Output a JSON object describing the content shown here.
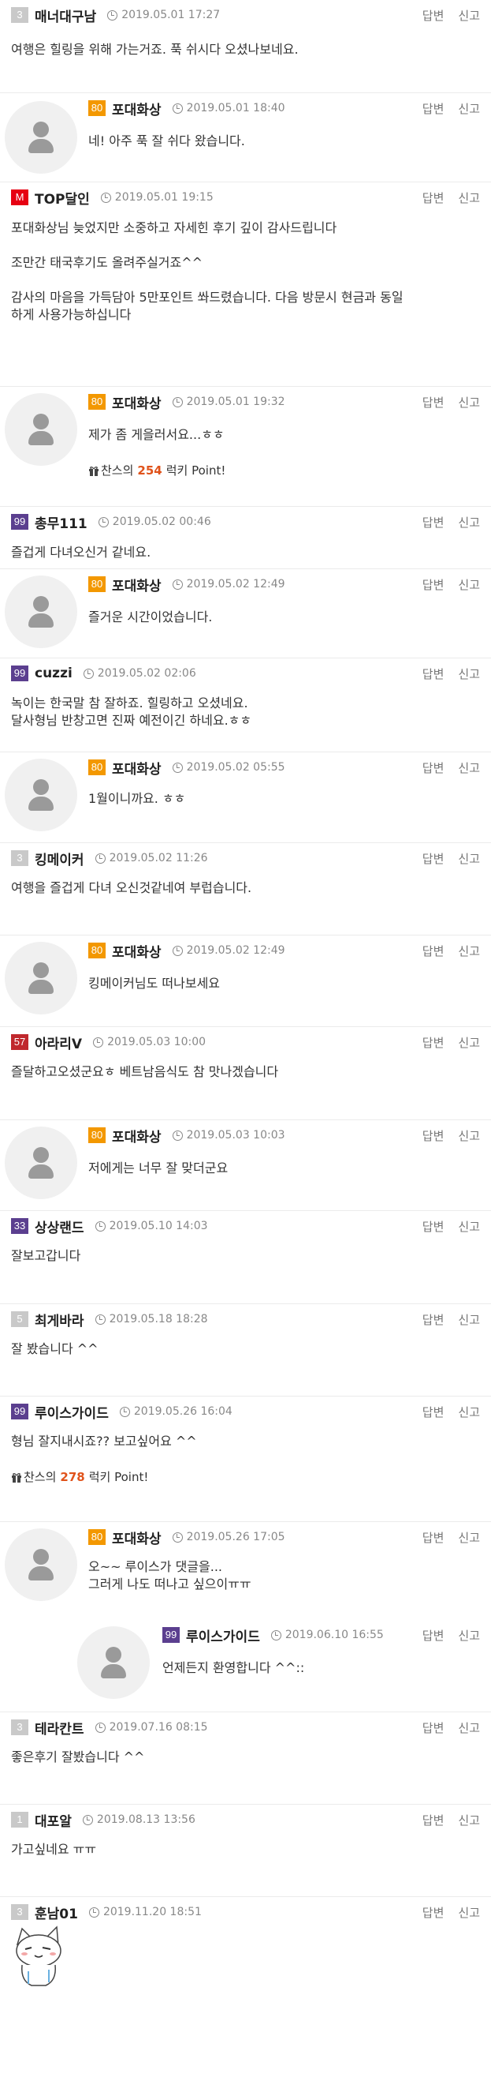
{
  "actions": {
    "reply": "답변",
    "report": "신고"
  },
  "comments": [
    {
      "level": "3",
      "color": "#c9c9c9",
      "nick": "매너대구남",
      "date": "2019.05.01 17:27",
      "text": "여행은 힐링을 위해 가는거죠. 푹 쉬시다 오셨나보네요."
    },
    {
      "level": "80",
      "color": "#f39800",
      "nick": "포대화상",
      "date": "2019.05.01 18:40",
      "text": "네! 아주 푹 잘 쉬다 왔습니다."
    },
    {
      "level": "M",
      "color": "#e60012",
      "nick": "TOP달인",
      "date": "2019.05.01 19:15",
      "text": "포대화상님 늦었지만 소중하고 자세힌 후기 깊이 감사드립니다\n\n조만간 태국후기도 올려주실거죠^^\n\n감사의 마음을 가득담아 5만포인트 쏴드렸습니다. 다음 방문시 현금과 동일\n하게 사용가능하십니다"
    },
    {
      "level": "80",
      "color": "#f39800",
      "nick": "포대화상",
      "date": "2019.05.01 19:32",
      "text": "제가 좀 게을러서요...ㅎㅎ",
      "point_prefix": "찬스의",
      "point_value": "254",
      "point_suffix": "럭키 Point!"
    },
    {
      "level": "99",
      "color": "#5b3f8f",
      "nick": "총무111",
      "date": "2019.05.02 00:46",
      "text": "즐겁게 다녀오신거 같네요."
    },
    {
      "level": "80",
      "color": "#f39800",
      "nick": "포대화상",
      "date": "2019.05.02 12:49",
      "text": "즐거운 시간이었습니다."
    },
    {
      "level": "99",
      "color": "#5b3f8f",
      "nick": "cuzzi",
      "date": "2019.05.02 02:06",
      "text": "녹이는 한국말 참 잘하죠. 힐링하고 오셨네요.\n달사형님 반창고면 진짜 예전이긴 하네요.ㅎㅎ"
    },
    {
      "level": "80",
      "color": "#f39800",
      "nick": "포대화상",
      "date": "2019.05.02 05:55",
      "text": "1월이니까요. ㅎㅎ"
    },
    {
      "level": "3",
      "color": "#c9c9c9",
      "nick": "킹메이커",
      "date": "2019.05.02 11:26",
      "text": "여행을 즐겁게 다녀 오신것같네여 부럽습니다."
    },
    {
      "level": "80",
      "color": "#f39800",
      "nick": "포대화상",
      "date": "2019.05.02 12:49",
      "text": "킹메이커님도 떠나보세요"
    },
    {
      "level": "57",
      "color": "#c0282d",
      "nick": "아라리V",
      "date": "2019.05.03 10:00",
      "text": "즐달하고오셨군요ㅎ 베트남음식도 참 맛나겠습니다"
    },
    {
      "level": "80",
      "color": "#f39800",
      "nick": "포대화상",
      "date": "2019.05.03 10:03",
      "text": "저에게는 너무 잘 맞더군요"
    },
    {
      "level": "33",
      "color": "#5b3f8f",
      "nick": "상상랜드",
      "date": "2019.05.10 14:03",
      "text": "잘보고갑니다"
    },
    {
      "level": "5",
      "color": "#c9c9c9",
      "nick": "최게바라",
      "date": "2019.05.18 18:28",
      "text": "잘 봤습니다 ^^"
    },
    {
      "level": "99",
      "color": "#5b3f8f",
      "nick": "루이스가이드",
      "date": "2019.05.26 16:04",
      "text": "형님 잘지내시죠?? 보고싶어요 ^^",
      "point_prefix": "찬스의",
      "point_value": "278",
      "point_suffix": "럭키 Point!"
    },
    {
      "level": "80",
      "color": "#f39800",
      "nick": "포대화상",
      "date": "2019.05.26 17:05",
      "text": "오~~ 루이스가 댓글을...\n그러게 나도 떠나고 싶으이ㅠㅠ"
    },
    {
      "level": "99",
      "color": "#5b3f8f",
      "nick": "루이스가이드",
      "date": "2019.06.10 16:55",
      "text": "언제든지 환영합니다 ^^::"
    },
    {
      "level": "3",
      "color": "#c9c9c9",
      "nick": "테라칸트",
      "date": "2019.07.16 08:15",
      "text": "좋은후기 잘봤습니다 ^^"
    },
    {
      "level": "1",
      "color": "#c9c9c9",
      "nick": "대포알",
      "date": "2019.08.13 13:56",
      "text": "가고싶네요 ㅠㅠ"
    },
    {
      "level": "3",
      "color": "#c9c9c9",
      "nick": "훈남01",
      "date": "2019.11.20 18:51",
      "text": ""
    }
  ]
}
